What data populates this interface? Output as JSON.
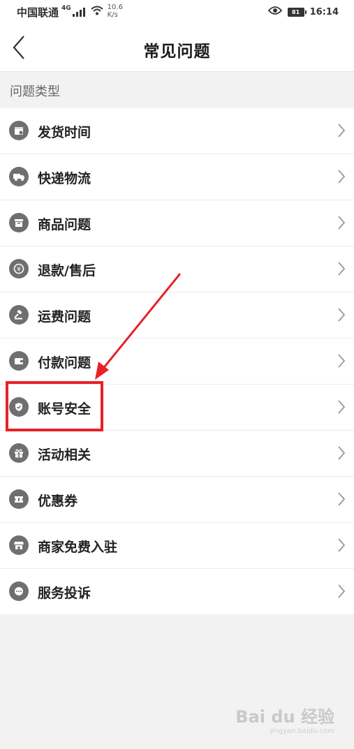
{
  "status_bar": {
    "carrier": "中国联通",
    "network": "4G",
    "speed_value": "10.6",
    "speed_unit": "K/s",
    "battery": "81",
    "time": "16:14"
  },
  "nav": {
    "title": "常见问题"
  },
  "section": {
    "title": "问题类型"
  },
  "items": [
    {
      "label": "发货时间",
      "icon": "calendar-icon"
    },
    {
      "label": "快递物流",
      "icon": "truck-icon"
    },
    {
      "label": "商品问题",
      "icon": "box-icon"
    },
    {
      "label": "退款/售后",
      "icon": "refund-yen-icon"
    },
    {
      "label": "运费问题",
      "icon": "gavel-icon"
    },
    {
      "label": "付款问题",
      "icon": "wallet-icon"
    },
    {
      "label": "账号安全",
      "icon": "shield-icon"
    },
    {
      "label": "活动相关",
      "icon": "gift-icon"
    },
    {
      "label": "优惠券",
      "icon": "coupon-icon"
    },
    {
      "label": "商家免费入驻",
      "icon": "store-icon"
    },
    {
      "label": "服务投诉",
      "icon": "chat-icon"
    }
  ],
  "watermark": {
    "main": "Bai du 经验",
    "sub": "jingyan.baidu.com"
  },
  "colors": {
    "annotation": "#e8202a",
    "icon_bg": "#6f6f6f"
  }
}
